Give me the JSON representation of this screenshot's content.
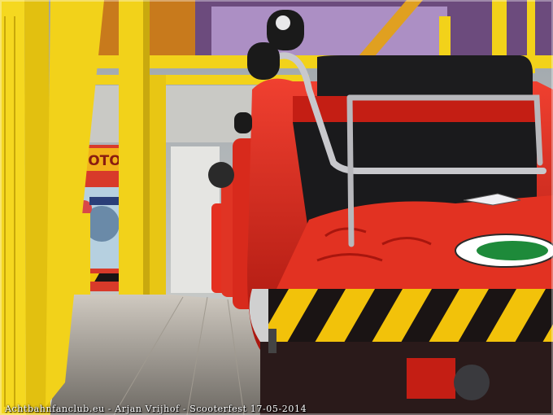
{
  "image": {
    "subject": "close-up of a red roller coaster train on a yellow station platform",
    "caption": "Achtbahnfanclub.eu - Arjan Vrijhof - Scooterfest 17-05-2014",
    "sign_text": "HOTOR"
  },
  "colors": {
    "yellow": "#f2d21a",
    "red": "#d8261a",
    "black": "#1a1414",
    "silver": "#c8c8cc",
    "sky": "#d9dde0"
  }
}
